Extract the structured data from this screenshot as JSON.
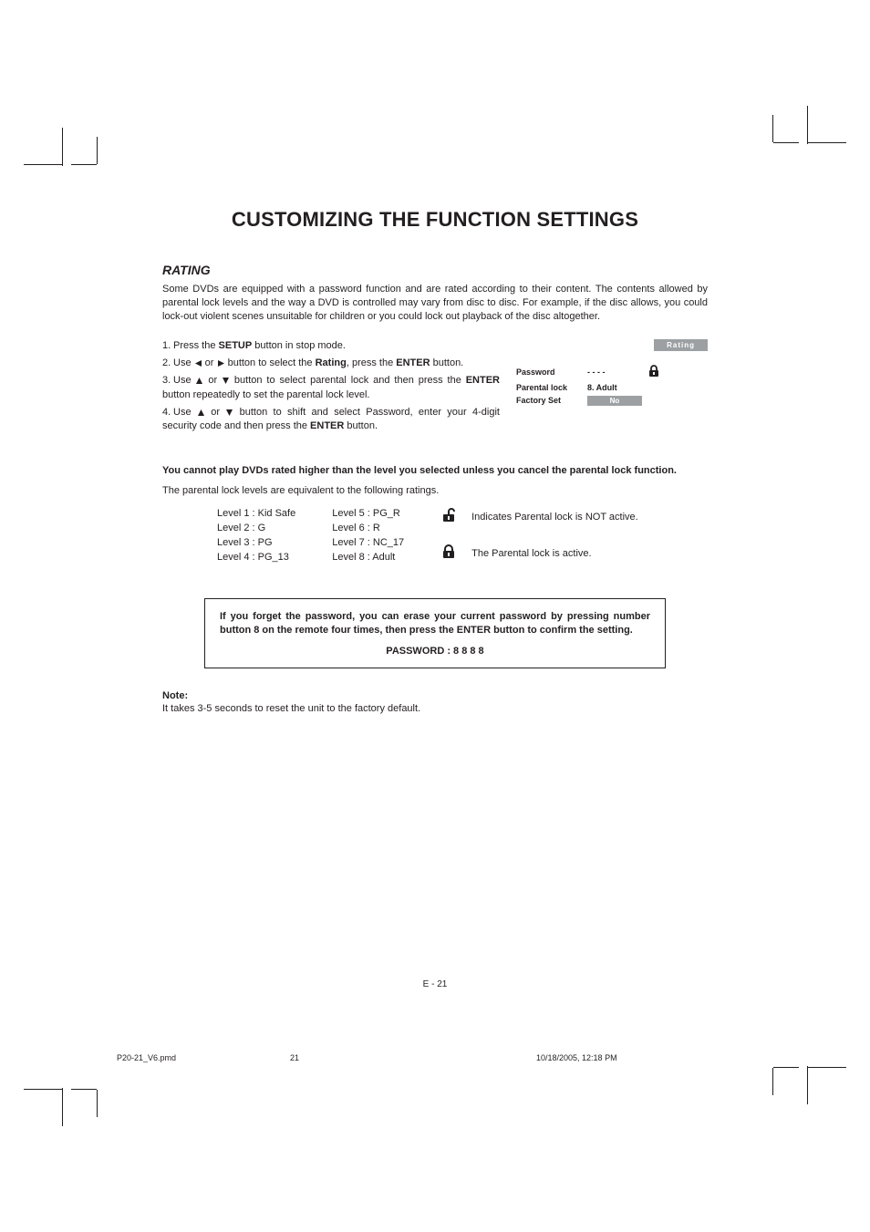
{
  "title": "CUSTOMIZING THE FUNCTION SETTINGS",
  "section_heading": "RATING",
  "intro": "Some DVDs are equipped with a password function and are rated according to their content. The contents allowed by parental lock levels and the way a DVD is controlled may vary from disc to disc. For example, if the disc allows, you could lock-out violent scenes unsuitable for children or you could lock out playback of the disc altogether.",
  "steps": {
    "s1a": "Press the ",
    "s1b": "SETUP",
    "s1c": " button in stop mode.",
    "s2a": "Use ",
    "s2b": " or ",
    "s2c": " button to select the ",
    "s2d": "Rating",
    "s2e": ", press the ",
    "s2f": "ENTER",
    "s2g": " button.",
    "s3a": "Use ",
    "s3b": " or ",
    "s3c": " button to select parental lock and then press the ",
    "s3d": "ENTER",
    "s3e": " button repeatedly to set the parental lock level.",
    "s4a": "Use ",
    "s4b": " or ",
    "s4c": " button to shift and select Password, enter your 4-digit security code and then press the ",
    "s4d": "ENTER",
    "s4e": " button."
  },
  "osd": {
    "tab": "Rating",
    "rows": [
      {
        "label": "Password",
        "value": "- - - -"
      },
      {
        "label": "Parental lock",
        "value": "8. Adult"
      },
      {
        "label": "Factory Set",
        "value": "No"
      }
    ]
  },
  "notice": "You cannot play DVDs rated higher than the level you selected unless you cancel the parental lock function.",
  "equiv_intro": "The parental lock levels are equivalent to the following ratings.",
  "levels_col1": [
    "Level 1 : Kid Safe",
    "Level 2 : G",
    "Level 3 : PG",
    "Level 4 : PG_13"
  ],
  "levels_col2": [
    "Level 5 : PG_R",
    "Level 6 : R",
    "Level 7 : NC_17",
    "Level 8 : Adult"
  ],
  "legend": {
    "unlocked": "Indicates Parental lock is NOT active.",
    "locked": "The Parental lock is active."
  },
  "callout": {
    "line1": "If you forget the password, you can erase your current password by pressing number button 8 on the remote four times, then press the ENTER button to confirm the setting.",
    "line2": "PASSWORD : 8 8 8 8"
  },
  "note_heading": "Note:",
  "note_body": "It takes 3-5 seconds to reset the unit to the factory default.",
  "page_footer": "E - 21",
  "doc_footer": {
    "file": "P20-21_V6.pmd",
    "page": "21",
    "datetime": "10/18/2005, 12:18 PM"
  }
}
